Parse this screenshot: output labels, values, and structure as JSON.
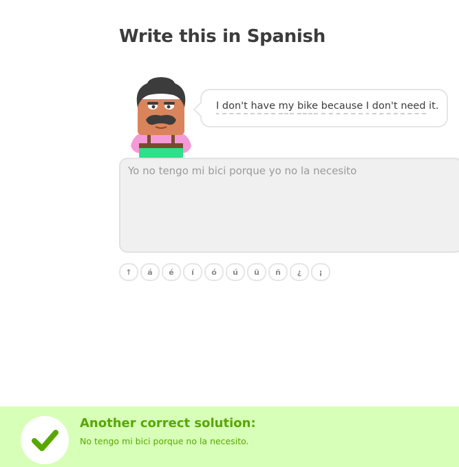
{
  "challenge": {
    "title": "Write this in Spanish"
  },
  "prompt": {
    "words": [
      "I",
      "don't",
      "have",
      "my",
      "bike",
      "because",
      "I",
      "don't",
      "need",
      "it."
    ]
  },
  "answer": {
    "value": "Yo no tengo mi bici porque yo no la necesito"
  },
  "special_keys": [
    "↑",
    "á",
    "é",
    "í",
    "ó",
    "ú",
    "ü",
    "ñ",
    "¿",
    "¡"
  ],
  "feedback": {
    "title": "Another correct solution:",
    "text": "No tengo mi bici porque no la necesito."
  },
  "colors": {
    "footer_bg": "#d7ffb8",
    "success": "#58a700",
    "check": "#58a700"
  }
}
